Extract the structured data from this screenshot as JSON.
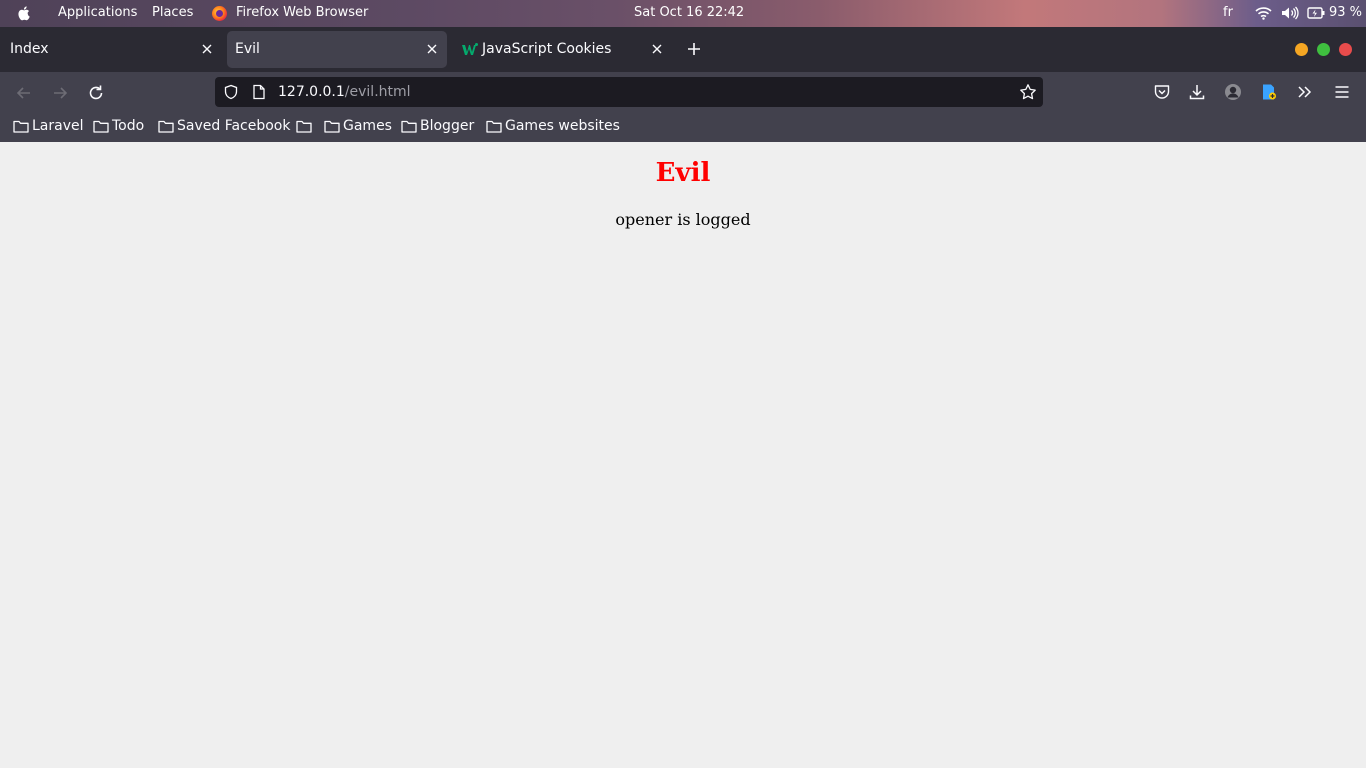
{
  "system_bar": {
    "menu_applications": "Applications",
    "menu_places": "Places",
    "active_app": "Firefox Web Browser",
    "datetime": "Sat Oct 16  22:42",
    "keyboard_layout": "fr",
    "battery_percent": "93 %",
    "icons": [
      "apple-logo-icon",
      "firefox-icon",
      "wifi-icon",
      "volume-icon",
      "battery-icon"
    ]
  },
  "tabs": [
    {
      "label": "Index",
      "active": false
    },
    {
      "label": "Evil",
      "active": true
    },
    {
      "label": "JavaScript Cookies",
      "active": false,
      "favicon": "w3schools-icon"
    }
  ],
  "window_controls": {
    "minimize_color": "#f5a623",
    "maximize_color": "#3fbf3f",
    "close_color": "#e84c4c"
  },
  "url": {
    "host": "127.0.0.1",
    "path": "/evil.html"
  },
  "bookmarks": [
    {
      "label": "Laravel"
    },
    {
      "label": "Todo"
    },
    {
      "label": "Saved Facebook"
    },
    {
      "label": ""
    },
    {
      "label": "Games"
    },
    {
      "label": "Blogger"
    },
    {
      "label": "Games websites"
    }
  ],
  "page": {
    "heading": "Evil",
    "heading_color": "#ff0000",
    "message": "opener is logged"
  }
}
